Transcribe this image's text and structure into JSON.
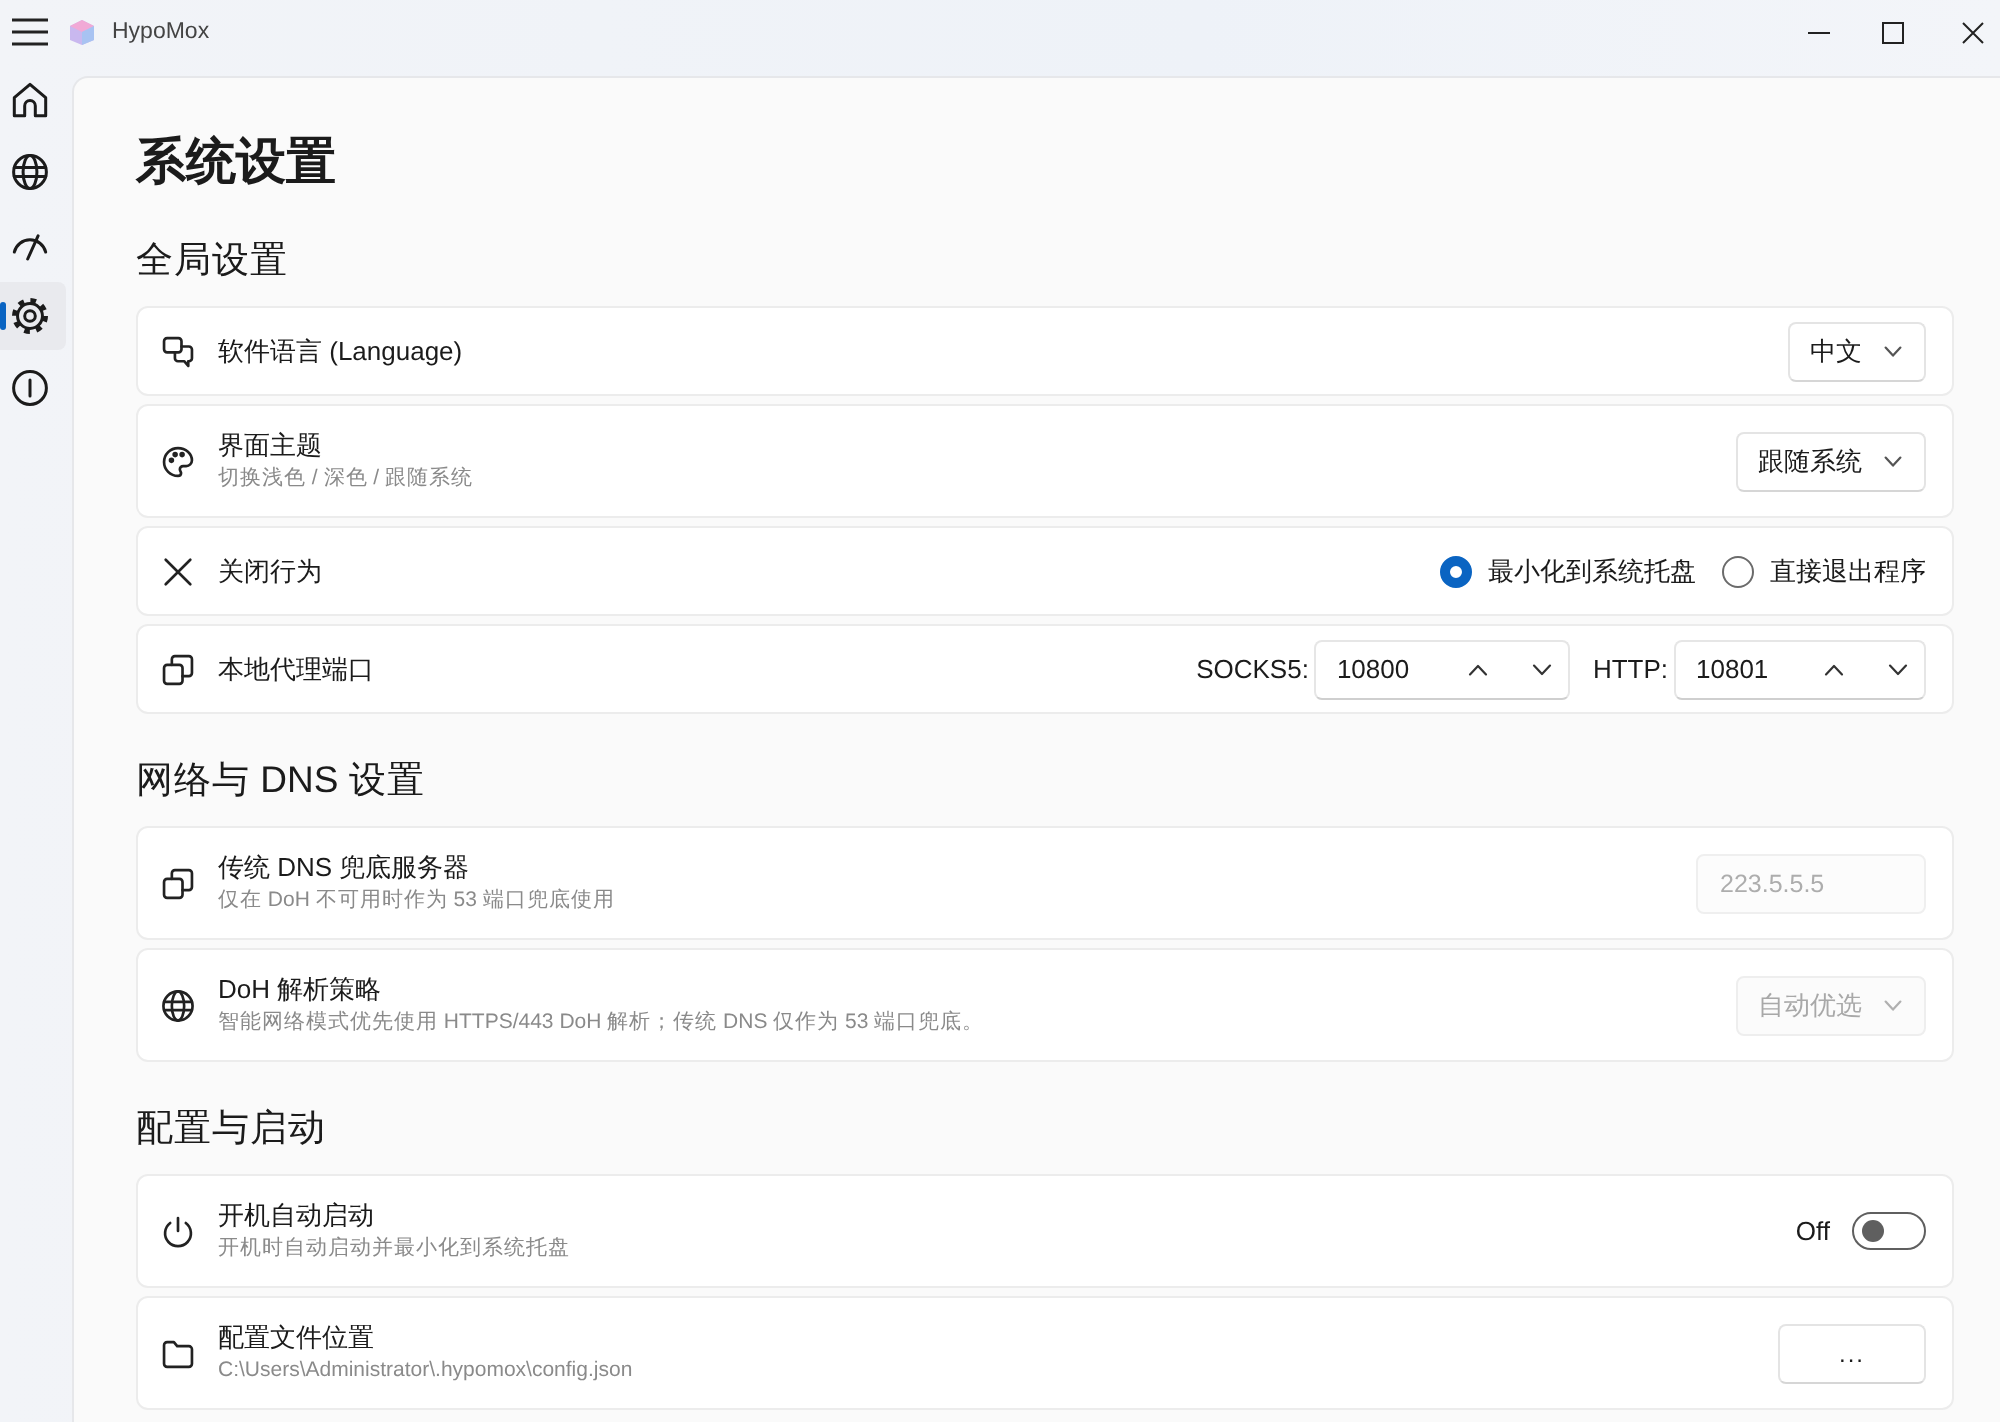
{
  "window": {
    "title": "HypoMox"
  },
  "nav": [
    {
      "selected": false
    },
    {
      "selected": false
    },
    {
      "selected": false
    },
    {
      "selected": true
    },
    {
      "selected": false
    }
  ],
  "page_title": "系统设置",
  "sections": [
    {
      "title": "全局设置",
      "rows": [
        {
          "kind": "dropdown",
          "label": "软件语言 (Language)",
          "value": "中文",
          "disabled": false
        },
        {
          "kind": "dropdown",
          "label": "界面主题",
          "description": "切换浅色 / 深色 / 跟随系统",
          "value": "跟随系统",
          "disabled": false
        },
        {
          "kind": "radio",
          "label": "关闭行为",
          "options": [
            {
              "label": "最小化到系统托盘",
              "selected": true
            },
            {
              "label": "直接退出程序",
              "selected": false
            }
          ]
        },
        {
          "kind": "ports",
          "label": "本地代理端口",
          "fields": [
            {
              "label": "SOCKS5:",
              "value": "10800"
            },
            {
              "label": "HTTP:",
              "value": "10801"
            }
          ]
        }
      ]
    },
    {
      "title": "网络与 DNS 设置",
      "rows": [
        {
          "kind": "input",
          "label": "传统 DNS 兜底服务器",
          "description": "仅在 DoH 不可用时作为 53 端口兜底使用",
          "value": "223.5.5.5",
          "disabled": true
        },
        {
          "kind": "dropdown",
          "label": "DoH 解析策略",
          "description": "智能网络模式优先使用 HTTPS/443 DoH 解析；传统 DNS 仅作为 53 端口兜底。",
          "value": "自动优选",
          "disabled": true
        }
      ]
    },
    {
      "title": "配置与启动",
      "rows": [
        {
          "kind": "toggle",
          "label": "开机自动启动",
          "description": "开机时自动启动并最小化到系统托盘",
          "state_label": "Off",
          "on": false
        },
        {
          "kind": "button",
          "label": "配置文件位置",
          "description": "C:\\Users\\Administrator\\.hypomox\\config.json",
          "button": "..."
        }
      ]
    }
  ]
}
